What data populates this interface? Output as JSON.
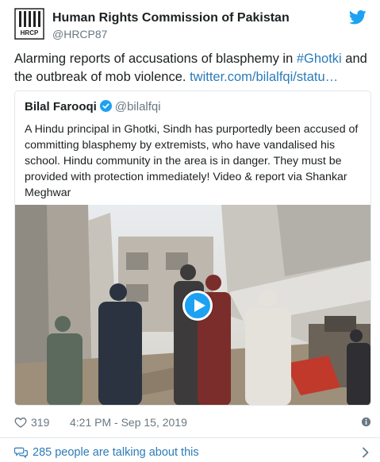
{
  "author": {
    "name": "Human Rights Commission of Pakistan",
    "handle": "@HRCP87",
    "logo_text": "HRCP"
  },
  "tweet": {
    "text_prefix": "Alarming reports of accusations of blasphemy in ",
    "hashtag": "#Ghotki",
    "text_middle": " and the outbreak of mob violence. ",
    "link": "twitter.com/bilalfqi/statu…"
  },
  "quote": {
    "name": "Bilal Farooqi",
    "handle": "@bilalfqi",
    "text": "A Hindu principal in Ghotki, Sindh has purportedly been accused of committing blasphemy by extremists, who have vandalised his school. Hindu community in the area is in danger. They must be provided with protection immediately! Video & report via Shankar Meghwar",
    "media": "video"
  },
  "meta": {
    "likes": "319",
    "timestamp": "4:21 PM - Sep 15, 2019"
  },
  "footer": {
    "talking": "285 people are talking about this"
  },
  "colors": {
    "link": "#2b7bb9",
    "twitter_blue": "#1da1f2",
    "secondary_text": "#697882",
    "border": "#e1e8ed"
  },
  "icons": [
    "hrcp-logo-icon",
    "twitter-bird-icon",
    "verified-badge-icon",
    "play-icon",
    "heart-icon",
    "info-icon",
    "speech-bubbles-icon",
    "chevron-right-icon"
  ]
}
